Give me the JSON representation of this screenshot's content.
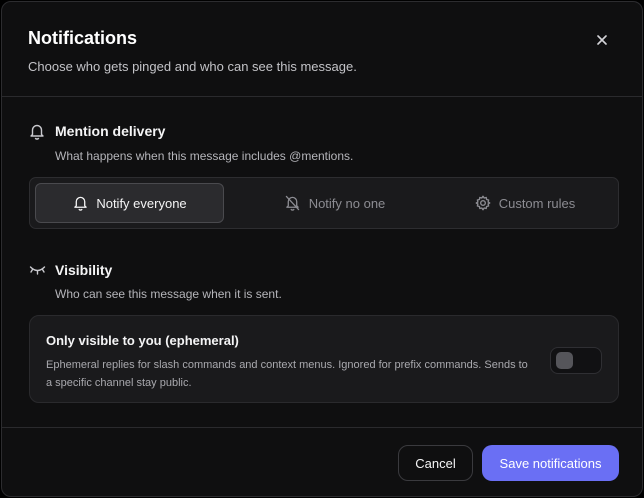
{
  "dialog": {
    "title": "Notifications",
    "subtitle": "Choose who gets pinged and who can see this message.",
    "close_icon": "close-icon"
  },
  "mention": {
    "icon": "bell-icon",
    "title": "Mention delivery",
    "description": "What happens when this message includes @mentions.",
    "options": [
      {
        "label": "Notify everyone",
        "icon": "bell-icon",
        "selected": true
      },
      {
        "label": "Notify no one",
        "icon": "bell-off-icon",
        "selected": false
      },
      {
        "label": "Custom rules",
        "icon": "gear-icon",
        "selected": false
      }
    ]
  },
  "visibility": {
    "icon": "eye-closed-icon",
    "title": "Visibility",
    "description": "Who can see this message when it is sent.",
    "option_title": "Only visible to you (ephemeral)",
    "option_description": "Ephemeral replies for slash commands and context menus. Ignored for prefix commands. Sends to a specific channel stay public.",
    "enabled": false
  },
  "footer": {
    "cancel_label": "Cancel",
    "save_label": "Save notifications"
  },
  "colors": {
    "accent": "#6a6ff4",
    "background": "#0f0f10"
  }
}
